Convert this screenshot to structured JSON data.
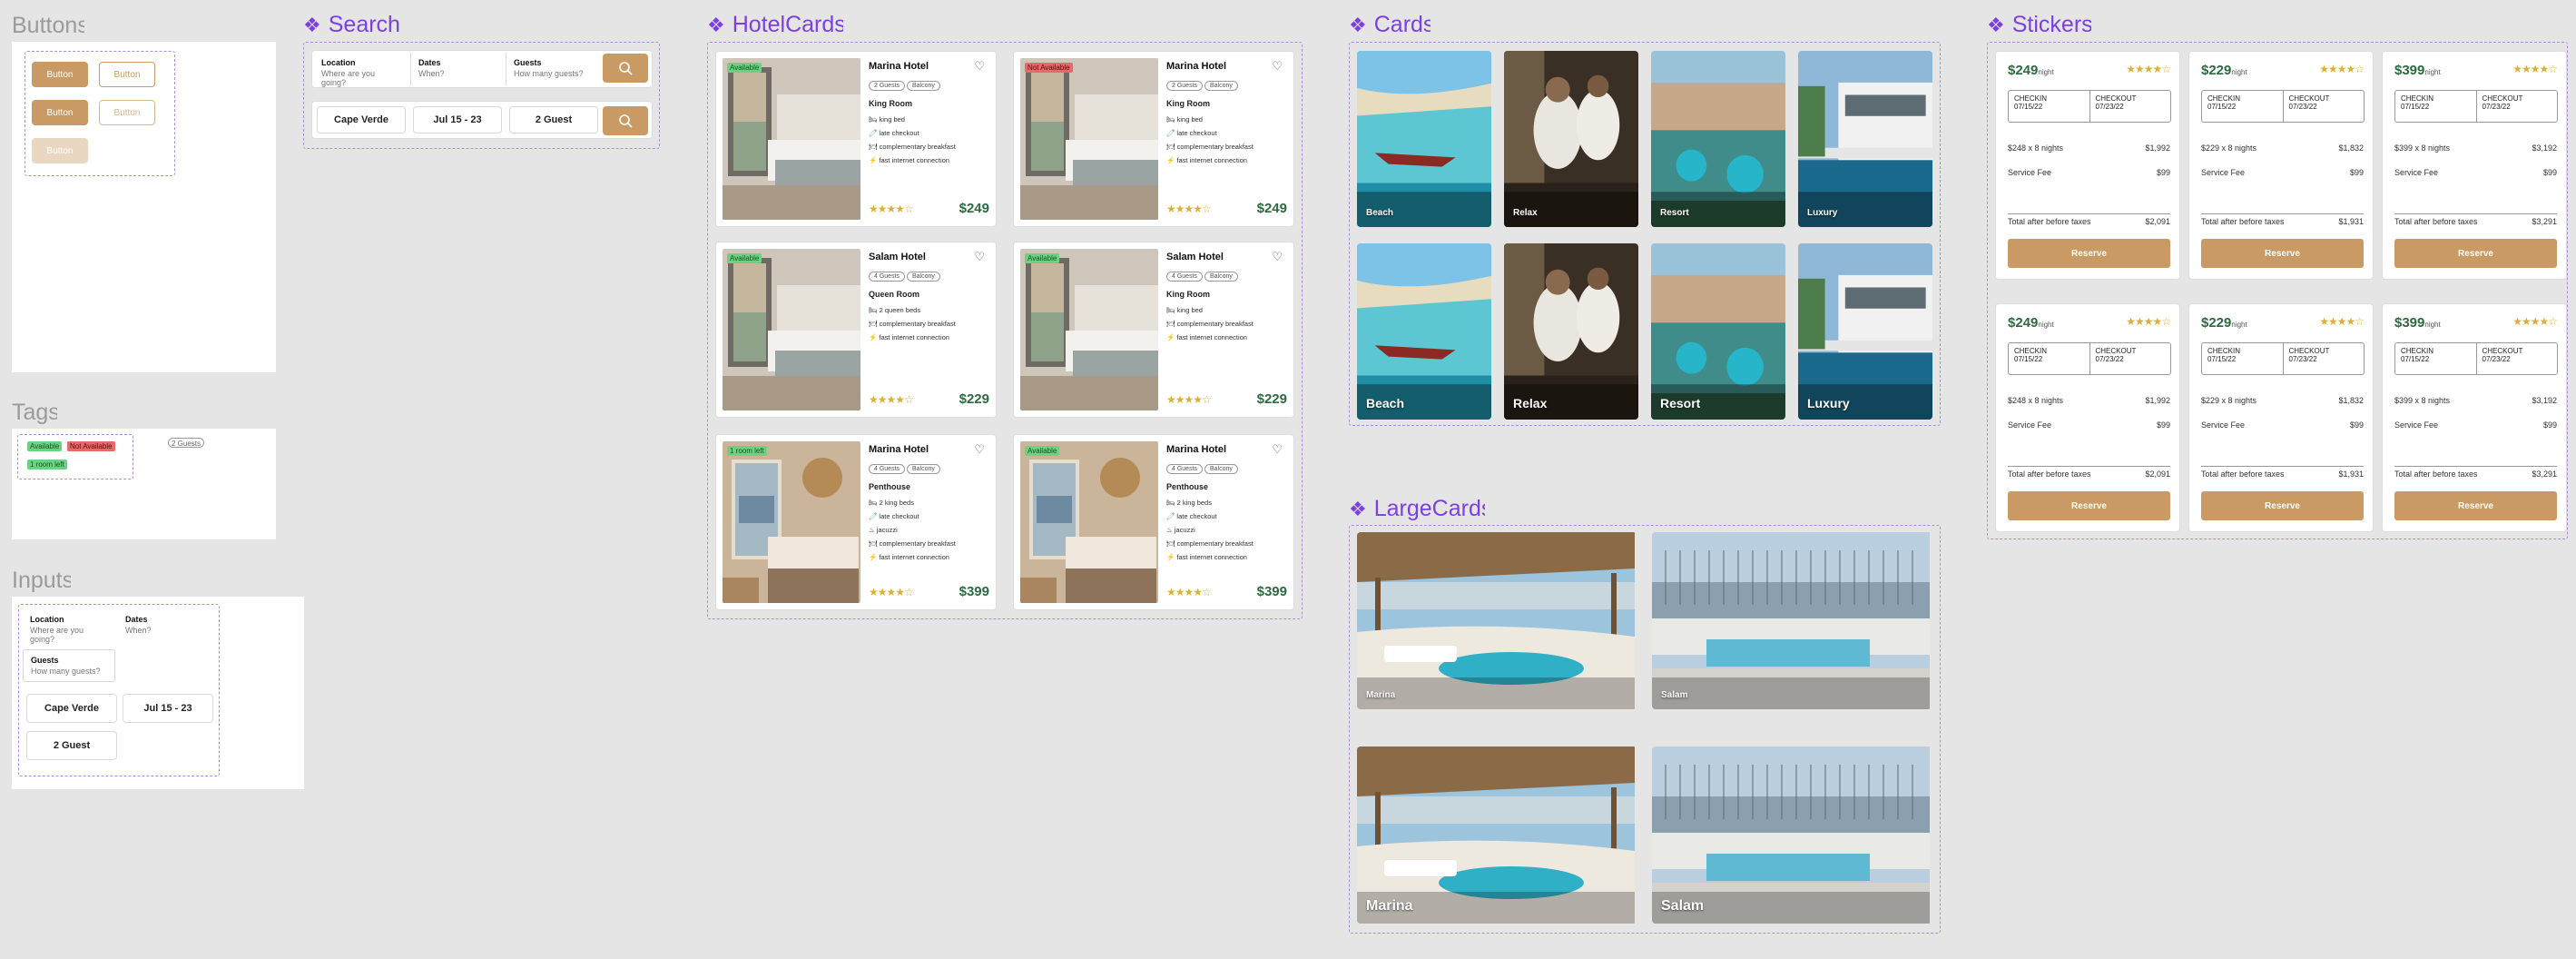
{
  "frames": {
    "buttons": "Buttons",
    "tags": "Tags",
    "inputs": "Inputs"
  },
  "components": {
    "search": "Search",
    "hotelcards": "HotelCards",
    "cards": "Cards",
    "largecards": "LargeCards",
    "stickers": "Stickers"
  },
  "buttons": {
    "label": "Button"
  },
  "tags": {
    "available": "Available",
    "not_available": "Not Available",
    "room_left": "1 room left",
    "guests": "2 Guests"
  },
  "inputs": {
    "location_label": "Location",
    "location_ph": "Where are you going?",
    "dates_label": "Dates",
    "dates_ph": "When?",
    "guests_label": "Guests",
    "guests_ph": "How many guests?",
    "dest": "Cape Verde",
    "dates": "Jul 15 - 23",
    "guest": "2 Guest"
  },
  "search": {
    "location_label": "Location",
    "location_ph": "Where are you going?",
    "dates_label": "Dates",
    "dates_ph": "When?",
    "guests_label": "Guests",
    "guests_ph": "How many guests?",
    "dest": "Cape Verde",
    "dates": "Jul 15 - 23",
    "guest": "2 Guest"
  },
  "hotels": [
    {
      "badge": "Available",
      "name": "Marina Hotel",
      "tag1": "2 Guests",
      "tag2": "Balcony",
      "room": "King Room",
      "f1": "🛏 king bed",
      "f2": "🧷 late checkout",
      "f3": "🍽 complementary breakfast",
      "f4": "⚡ fast internet connection",
      "price": "$249"
    },
    {
      "badge": "Not Available",
      "name": "Marina Hotel",
      "tag1": "2 Guests",
      "tag2": "Balcony",
      "room": "King Room",
      "f1": "🛏 king bed",
      "f2": "🧷 late checkout",
      "f3": "🍽 complementary breakfast",
      "f4": "⚡ fast internet connection",
      "price": "$249"
    },
    {
      "badge": "Available",
      "name": "Salam Hotel",
      "tag1": "4 Guests",
      "tag2": "Balcony",
      "room": "Queen Room",
      "f1": "🛏 2 queen beds",
      "f2": "🍽 complementary breakfast",
      "f3": "⚡ fast internet connection",
      "f4": "",
      "price": "$229"
    },
    {
      "badge": "Available",
      "name": "Salam Hotel",
      "tag1": "4 Guests",
      "tag2": "Balcony",
      "room": "King Room",
      "f1": "🛏 king bed",
      "f2": "🍽 complementary breakfast",
      "f3": "⚡ fast internet connection",
      "f4": "",
      "price": "$229"
    },
    {
      "badge": "1 room left",
      "name": "Marina Hotel",
      "tag1": "4 Guests",
      "tag2": "Balcony",
      "room": "Penthouse",
      "f1": "🛏 2 king beds",
      "f2": "🧷 late checkout",
      "f3": "♨ jacuzzi",
      "f4": "🍽 complementary breakfast",
      "f5": "⚡ fast internet connection",
      "price": "$399"
    },
    {
      "badge": "Available",
      "name": "Marina Hotel",
      "tag1": "4 Guests",
      "tag2": "Balcony",
      "room": "Penthouse",
      "f1": "🛏 2 king beds",
      "f2": "🧷 late checkout",
      "f3": "♨ jacuzzi",
      "f4": "🍽 complementary breakfast",
      "f5": "⚡ fast internet connection",
      "price": "$399"
    }
  ],
  "cards": [
    "Beach",
    "Relax",
    "Resort",
    "Luxury"
  ],
  "largecards": [
    "Marina",
    "Salam"
  ],
  "stickers": [
    {
      "price": "$249",
      "unit": "night",
      "checkin": "CHECKIN",
      "checkin_v": "07/15/22",
      "checkout": "CHECKOUT",
      "checkout_v": "07/23/22",
      "line1": "$248 x 8 nights",
      "line1_v": "$1,992",
      "fee": "Service Fee",
      "fee_v": "$99",
      "total": "Total after before taxes",
      "total_v": "$2,091",
      "btn": "Reserve"
    },
    {
      "price": "$229",
      "unit": "night",
      "checkin": "CHECKIN",
      "checkin_v": "07/15/22",
      "checkout": "CHECKOUT",
      "checkout_v": "07/23/22",
      "line1": "$229 x 8 nights",
      "line1_v": "$1,832",
      "fee": "Service Fee",
      "fee_v": "$99",
      "total": "Total after before taxes",
      "total_v": "$1,931",
      "btn": "Reserve"
    },
    {
      "price": "$399",
      "unit": "night",
      "checkin": "CHECKIN",
      "checkin_v": "07/15/22",
      "checkout": "CHECKOUT",
      "checkout_v": "07/23/22",
      "line1": "$399 x 8 nights",
      "line1_v": "$3,192",
      "fee": "Service Fee",
      "fee_v": "$99",
      "total": "Total after before taxes",
      "total_v": "$3,291",
      "btn": "Reserve"
    }
  ],
  "colors": {
    "accent": "#c99a63",
    "purple": "#7b3fe4",
    "price": "#2d6a3e"
  }
}
